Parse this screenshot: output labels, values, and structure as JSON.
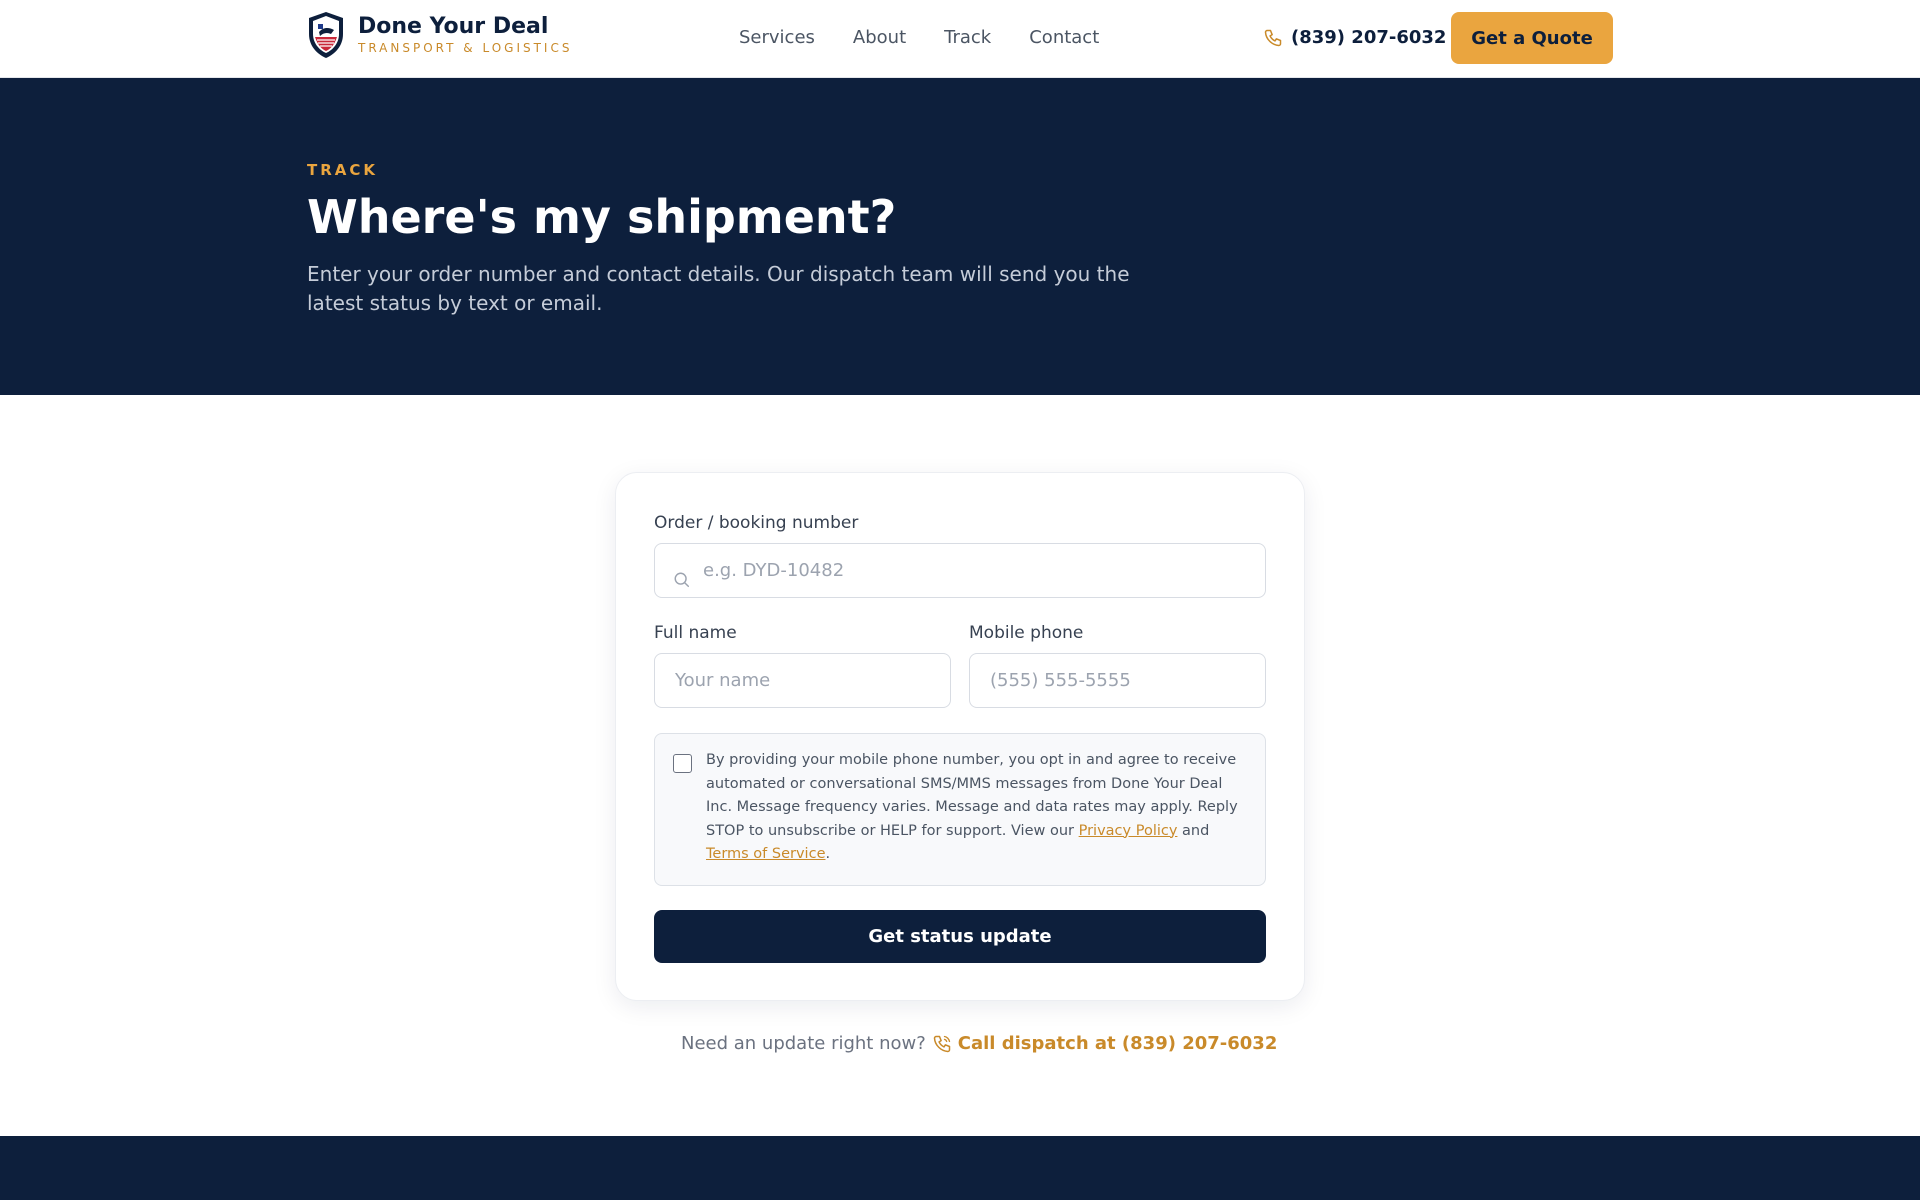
{
  "brand": {
    "name": "Done Your Deal",
    "tagline": "TRANSPORT & LOGISTICS"
  },
  "nav": {
    "items": [
      "Services",
      "About",
      "Track",
      "Contact"
    ]
  },
  "header": {
    "phone": "(839) 207-6032",
    "quote_label": "Get a Quote"
  },
  "hero": {
    "eyebrow": "TRACK",
    "title": "Where's my shipment?",
    "description": "Enter your order number and contact details. Our dispatch team will send you the latest status by text or email."
  },
  "form": {
    "order_label": "Order / booking number",
    "order_placeholder": "e.g. DYD-10482",
    "name_label": "Full name",
    "name_placeholder": "Your name",
    "phone_label": "Mobile phone",
    "phone_placeholder": "(555) 555-5555",
    "consent_text": "By providing your mobile phone number, you opt in and agree to receive automated or conversational SMS/MMS messages from Done Your Deal Inc. Message frequency varies. Message and data rates may apply. Reply STOP to unsubscribe or HELP for support. View our ",
    "privacy_link": "Privacy Policy",
    "consent_and": " and ",
    "terms_link": "Terms of Service",
    "consent_end": ".",
    "consent_checked": false,
    "submit_label": "Get status update"
  },
  "help": {
    "text": "Need an update right now?",
    "link": "Call dispatch at (839) 207-6032"
  },
  "colors": {
    "navy": "#0d1f3c",
    "accent": "#eaa53f",
    "link": "#c98a2a"
  }
}
